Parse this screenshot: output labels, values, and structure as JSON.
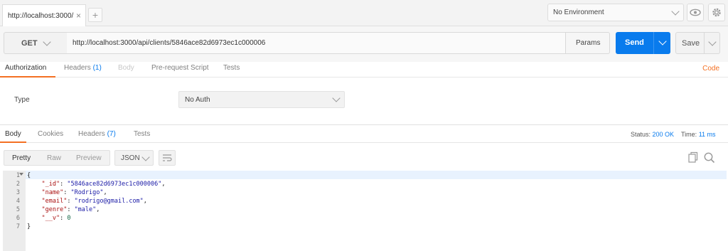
{
  "tabs": [
    {
      "label": "http://localhost:3000/",
      "close": "×"
    }
  ],
  "new_tab_label": "+",
  "environment": {
    "selected": "No Environment"
  },
  "request": {
    "method": "GET",
    "url": "http://localhost:3000/api/clients/5846ace82d6973ec1c000006",
    "params_label": "Params",
    "send_label": "Send",
    "save_label": "Save"
  },
  "request_tabs": {
    "authorization": "Authorization",
    "headers": "Headers",
    "headers_count": "(1)",
    "body": "Body",
    "prerequest": "Pre-request Script",
    "tests": "Tests",
    "code": "Code"
  },
  "auth": {
    "type_label": "Type",
    "type_value": "No Auth"
  },
  "response_tabs": {
    "body": "Body",
    "cookies": "Cookies",
    "headers": "Headers",
    "headers_count": "(7)",
    "tests": "Tests"
  },
  "status": {
    "label": "Status:",
    "value": "200 OK",
    "time_label": "Time:",
    "time_value": "11 ms"
  },
  "view_modes": {
    "pretty": "Pretty",
    "raw": "Raw",
    "preview": "Preview"
  },
  "format": "JSON",
  "editor": {
    "line_numbers": [
      "1",
      "2",
      "3",
      "4",
      "5",
      "6",
      "7"
    ],
    "lines": [
      {
        "t": "{"
      },
      {
        "k": "\"_id\"",
        "v": "\"5846ace82d6973ec1c000006\"",
        "tail": ","
      },
      {
        "k": "\"name\"",
        "v": "\"Rodrigo\"",
        "tail": ","
      },
      {
        "k": "\"email\"",
        "v": "\"rodrigo@gmail.com\"",
        "tail": ","
      },
      {
        "k": "\"genre\"",
        "v": "\"male\"",
        "tail": ","
      },
      {
        "k": "\"__v\"",
        "v": "0",
        "tail": "",
        "num": true
      },
      {
        "t": "}"
      }
    ]
  },
  "colors": {
    "accent": "#f47023",
    "primary": "#097bed"
  }
}
